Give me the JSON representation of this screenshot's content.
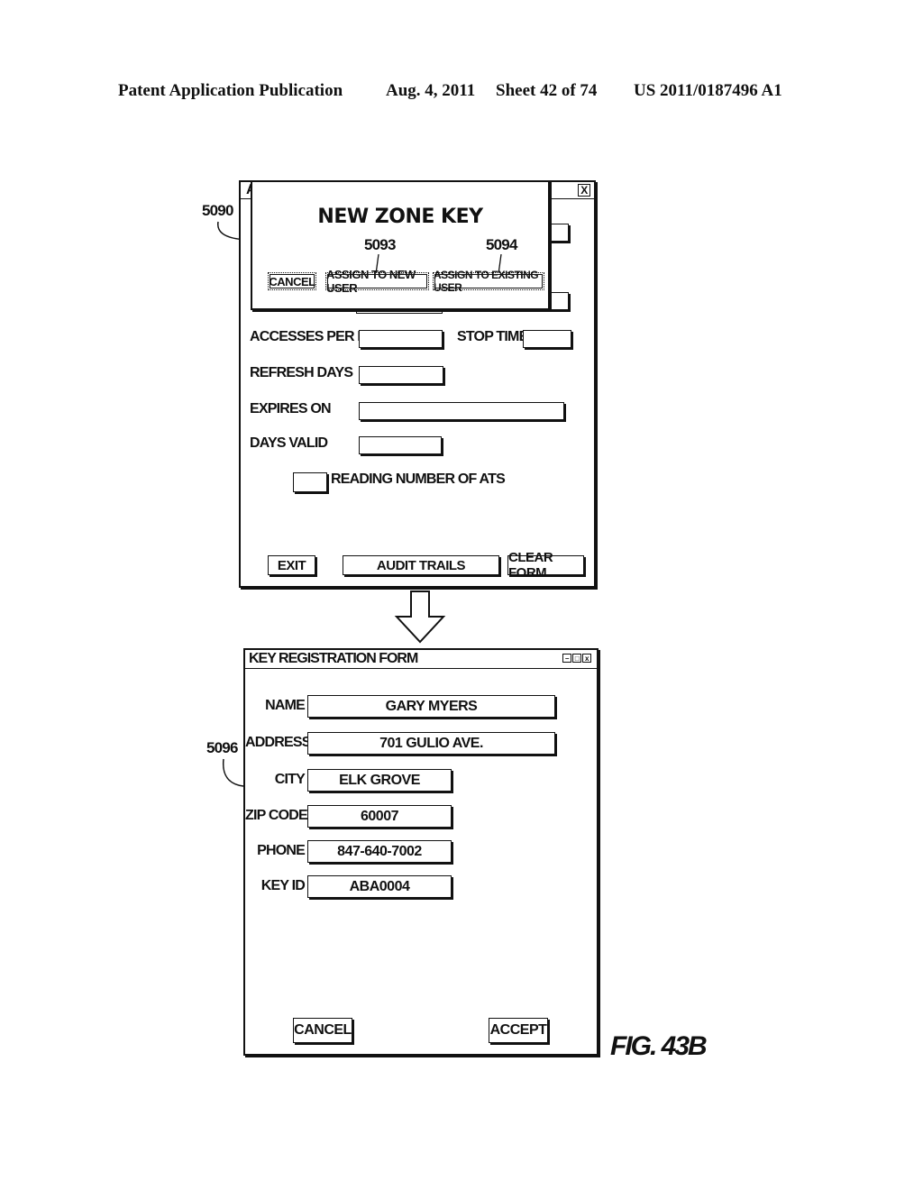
{
  "header": {
    "publication": "Patent Application Publication",
    "date": "Aug. 4, 2011",
    "sheet": "Sheet 42 of 74",
    "patent_number": "US 2011/0187496 A1"
  },
  "figure_label": "FIG. 43B",
  "reference_numerals": {
    "dialog": "5090",
    "assign_new_user": "5093",
    "assign_existing_user": "5094",
    "registration_form": "5096"
  },
  "top_window": {
    "title_partial": "A",
    "close_icon": "X",
    "fields": [
      {
        "label": "ACCESSES PER DAY",
        "value": ""
      },
      {
        "label": "STOP TIME",
        "value": ""
      },
      {
        "label": "REFRESH DAYS",
        "value": ""
      },
      {
        "label": "EXPIRES ON",
        "value": ""
      },
      {
        "label": "DAYS VALID",
        "value": ""
      }
    ],
    "checkbox": {
      "label": "READING NUMBER OF ATS",
      "checked": false
    },
    "buttons": {
      "exit": "EXIT",
      "audit_trails": "AUDIT TRAILS",
      "clear_form": "CLEAR FORM"
    }
  },
  "dialog": {
    "title": "NEW ZONE KEY",
    "buttons": {
      "cancel": "CANCEL",
      "assign_new": "ASSIGN TO NEW USER",
      "assign_existing": "ASSIGN TO EXISTING USER"
    }
  },
  "arrow": "down-arrow",
  "registration_form": {
    "title": "KEY REGISTRATION FORM",
    "window_controls": [
      "minimize",
      "maximize",
      "close"
    ],
    "fields": [
      {
        "label": "NAME",
        "value": "GARY MYERS"
      },
      {
        "label": "ADDRESS",
        "value": "701 GULIO AVE."
      },
      {
        "label": "CITY",
        "value": "ELK GROVE"
      },
      {
        "label": "ZIP CODE",
        "value": "60007"
      },
      {
        "label": "PHONE",
        "value": "847-640-7002"
      },
      {
        "label": "KEY ID",
        "value": "ABA0004"
      }
    ],
    "buttons": {
      "cancel": "CANCEL",
      "accept": "ACCEPT"
    }
  }
}
